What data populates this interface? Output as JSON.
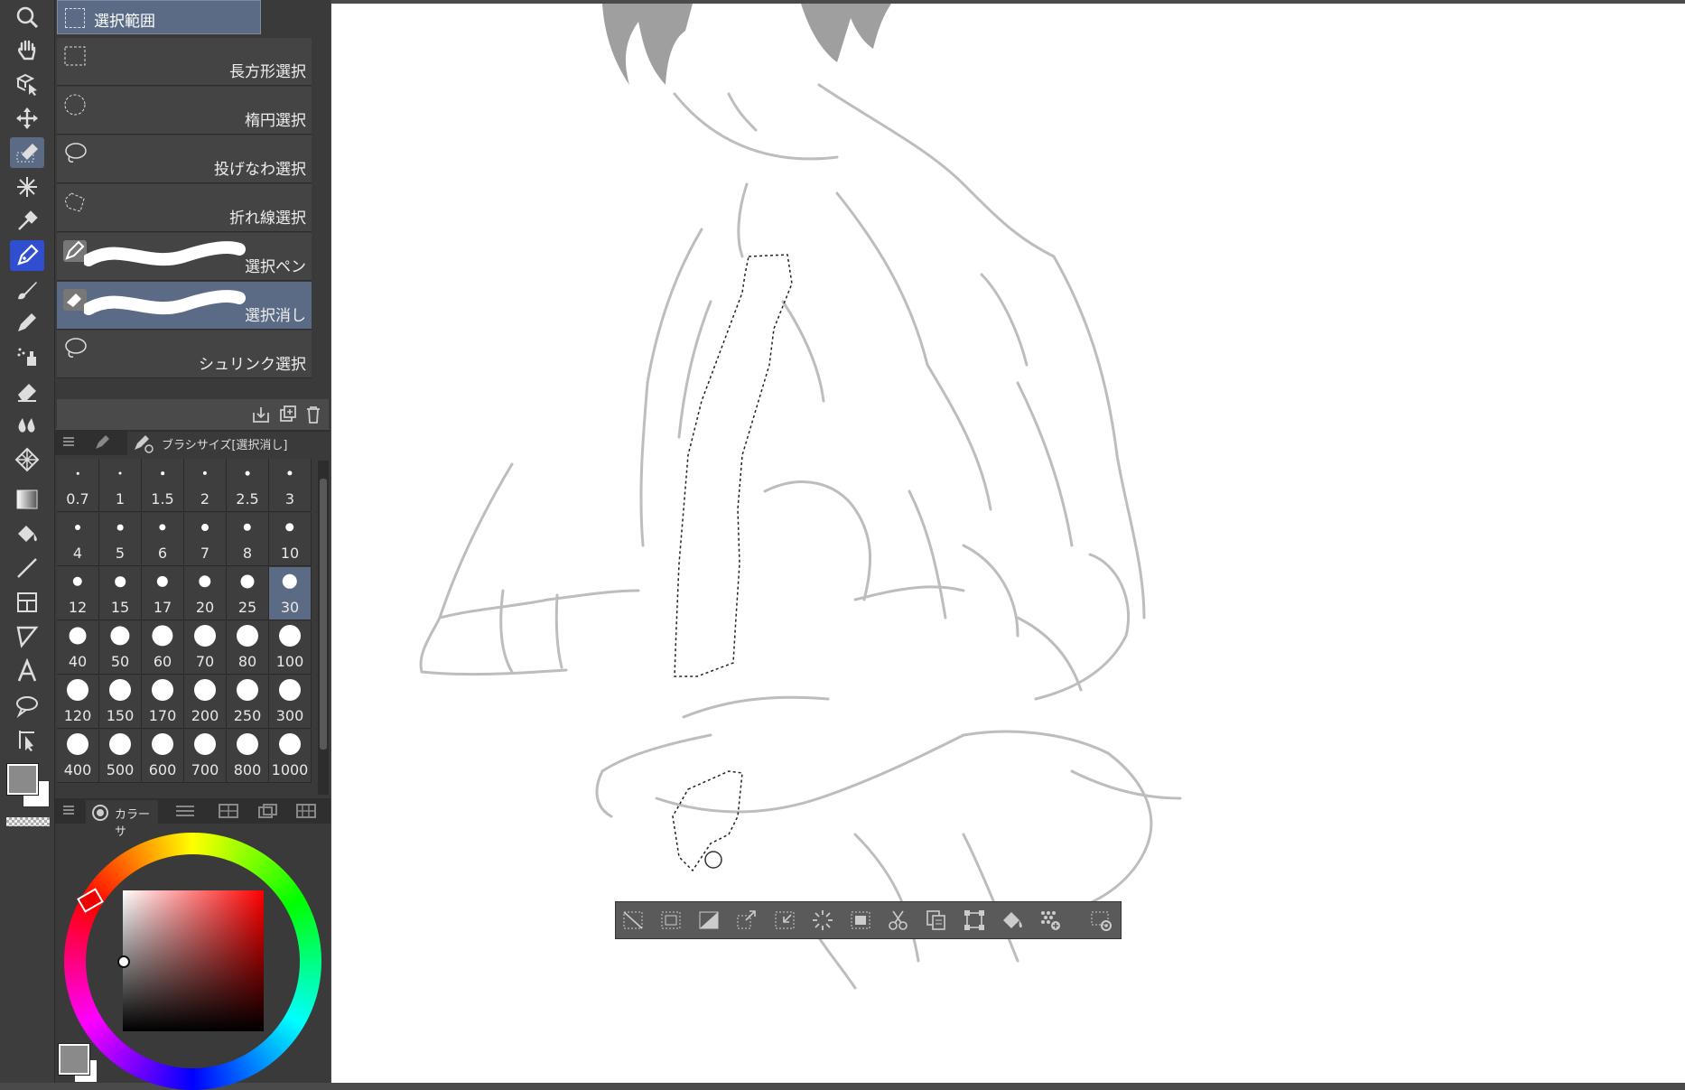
{
  "toolbar": {
    "tools": [
      {
        "name": "zoom-tool-icon",
        "active": false
      },
      {
        "name": "hand-tool-icon",
        "active": false
      },
      {
        "name": "operation-tool-icon",
        "active": false
      },
      {
        "name": "move-layer-tool-icon",
        "active": false
      },
      {
        "name": "selection-tool-icon",
        "active": true
      },
      {
        "name": "auto-select-tool-icon",
        "active": false
      },
      {
        "name": "eyedropper-tool-icon",
        "active": false
      },
      {
        "name": "pen-tool-icon",
        "active": true
      },
      {
        "name": "brush-tool-icon",
        "active": false
      },
      {
        "name": "pencil-tool-icon",
        "active": false
      },
      {
        "name": "airbrush-tool-icon",
        "active": false
      },
      {
        "name": "eraser-tool-icon",
        "active": false
      },
      {
        "name": "blend-tool-icon",
        "active": false
      },
      {
        "name": "decoration-tool-icon",
        "active": false
      },
      {
        "name": "gradient-tool-icon",
        "active": false
      },
      {
        "name": "fill-tool-icon",
        "active": false
      },
      {
        "name": "figure-tool-icon",
        "active": false
      },
      {
        "name": "frame-tool-icon",
        "active": false
      },
      {
        "name": "ruler-tool-icon",
        "active": false
      },
      {
        "name": "text-tool-icon",
        "active": false
      },
      {
        "name": "balloon-tool-icon",
        "active": false
      },
      {
        "name": "correct-line-tool-icon",
        "active": false
      }
    ],
    "colors": {
      "main": "#8a8a8a",
      "sub": "#ffffff"
    }
  },
  "subtool": {
    "header": "選択範囲",
    "items": [
      {
        "label": "長方形選択",
        "selected": false
      },
      {
        "label": "楕円選択",
        "selected": false
      },
      {
        "label": "投げなわ選択",
        "selected": false
      },
      {
        "label": "折れ線選択",
        "selected": false
      },
      {
        "label": "選択ペン",
        "selected": false
      },
      {
        "label": "選択消し",
        "selected": true
      },
      {
        "label": "シュリンク選択",
        "selected": false
      }
    ]
  },
  "brush_size": {
    "tab_title": "ブラシサイズ[選択消し]",
    "selected": "30",
    "sizes": [
      "0.7",
      "1",
      "1.5",
      "2",
      "2.5",
      "3",
      "4",
      "5",
      "6",
      "7",
      "8",
      "10",
      "12",
      "15",
      "17",
      "20",
      "25",
      "30",
      "40",
      "50",
      "60",
      "70",
      "80",
      "100",
      "120",
      "150",
      "170",
      "200",
      "250",
      "300",
      "400",
      "500",
      "600",
      "700",
      "800",
      "1000"
    ]
  },
  "color": {
    "tab_title": "カラーサ",
    "main_color": "#8a8a8a",
    "sub_color": "#ffffff",
    "hue": "#ff0000"
  },
  "command_bar": {
    "buttons": [
      "deselect-icon",
      "select-all-icon",
      "invert-selection-icon",
      "expand-selection-icon",
      "shrink-selection-icon",
      "select-range-icon",
      "selection-edge-icon",
      "cut-icon",
      "copy-paste-icon",
      "transform-icon",
      "fill-icon",
      "new-tone-icon",
      "selection-settings-icon"
    ]
  }
}
